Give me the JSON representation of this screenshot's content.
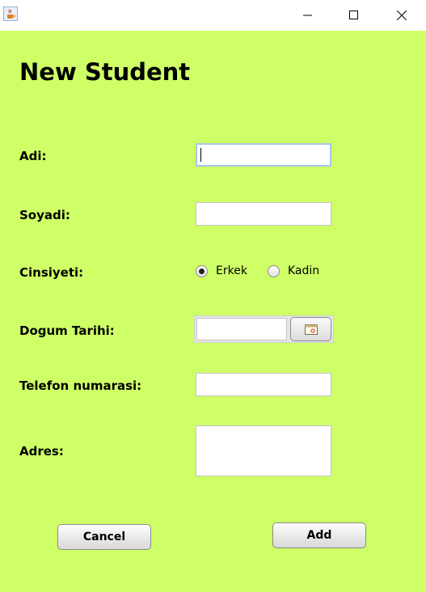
{
  "window": {
    "icon": "java-cup-icon",
    "controls": [
      "minimize-icon",
      "maximize-icon",
      "close-icon"
    ]
  },
  "form": {
    "heading": "New Student",
    "labels": {
      "adi": "Adi:",
      "soyadi": "Soyadi:",
      "cinsiyeti": "Cinsiyeti:",
      "dogum_tarihi": "Dogum Tarihi:",
      "telefon": "Telefon numarasi:",
      "adres": "Adres:"
    },
    "values": {
      "adi": "",
      "soyadi": "",
      "dogum_tarihi": "",
      "telefon": "",
      "adres": ""
    },
    "gender": {
      "options": [
        "Erkek",
        "Kadin"
      ],
      "selected": "Erkek"
    },
    "date_picker_icon": "calendar-icon"
  },
  "buttons": {
    "cancel": "Cancel",
    "add": "Add"
  },
  "colors": {
    "background": "#cfff66",
    "field_focus": "#a7c7e3"
  }
}
